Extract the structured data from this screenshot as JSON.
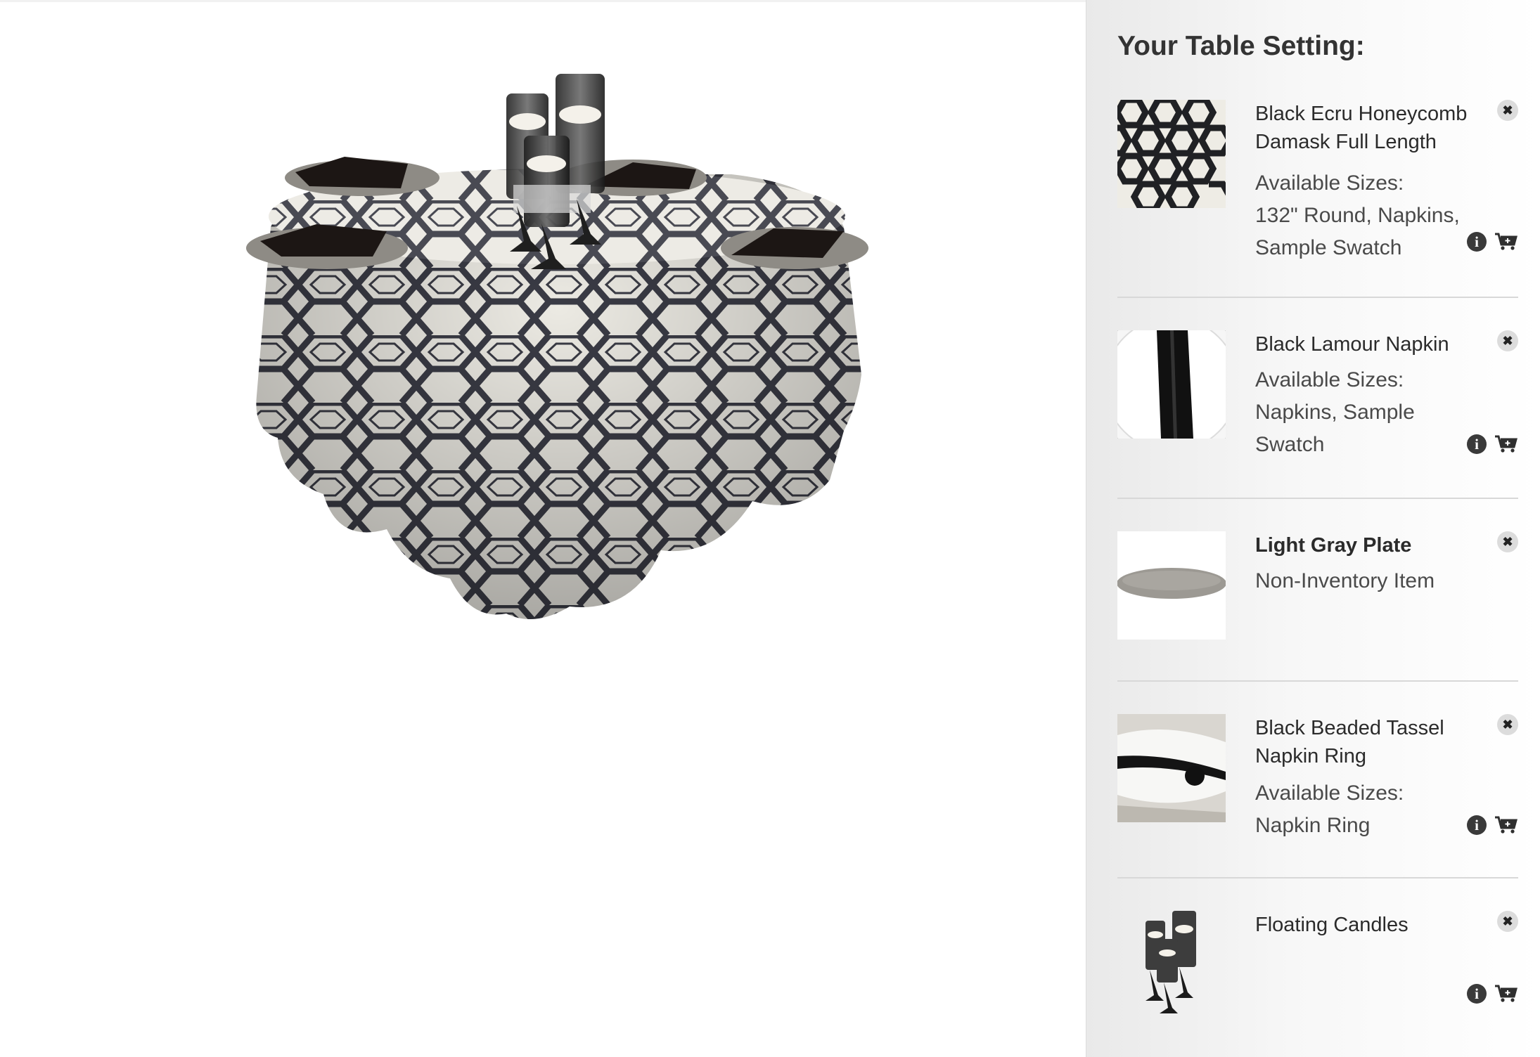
{
  "panel": {
    "title": "Your Table Setting:",
    "items": [
      {
        "name": "Black Ecru Honeycomb Damask Full Length",
        "sizes_label": "Available Sizes:",
        "sizes": "132\" Round, Napkins, Sample Swatch",
        "thumb": "honeycomb-swatch"
      },
      {
        "name": "Black Lamour Napkin",
        "sizes_label": "Available Sizes:",
        "sizes": "Napkins, Sample Swatch",
        "thumb": "napkin-on-plate"
      },
      {
        "name": "Light Gray Plate",
        "sizes_label": "",
        "sizes": "Non-Inventory Item",
        "thumb": "gray-plate"
      },
      {
        "name": "Black Beaded Tassel Napkin Ring",
        "sizes_label": "Available Sizes:",
        "sizes": "Napkin Ring",
        "thumb": "beaded-napkin-ring"
      },
      {
        "name": "Floating Candles",
        "sizes_label": "",
        "sizes": "",
        "thumb": "floating-candles"
      }
    ]
  },
  "icons": {
    "remove": "close-icon",
    "info": "info-icon",
    "cart": "add-to-cart-icon",
    "remove_glyph": "✖",
    "info_glyph": "i"
  },
  "colors": {
    "pattern_dark": "#3a3b45",
    "pattern_light": "#eceae3",
    "panel_bg": "#f3f3f3"
  }
}
